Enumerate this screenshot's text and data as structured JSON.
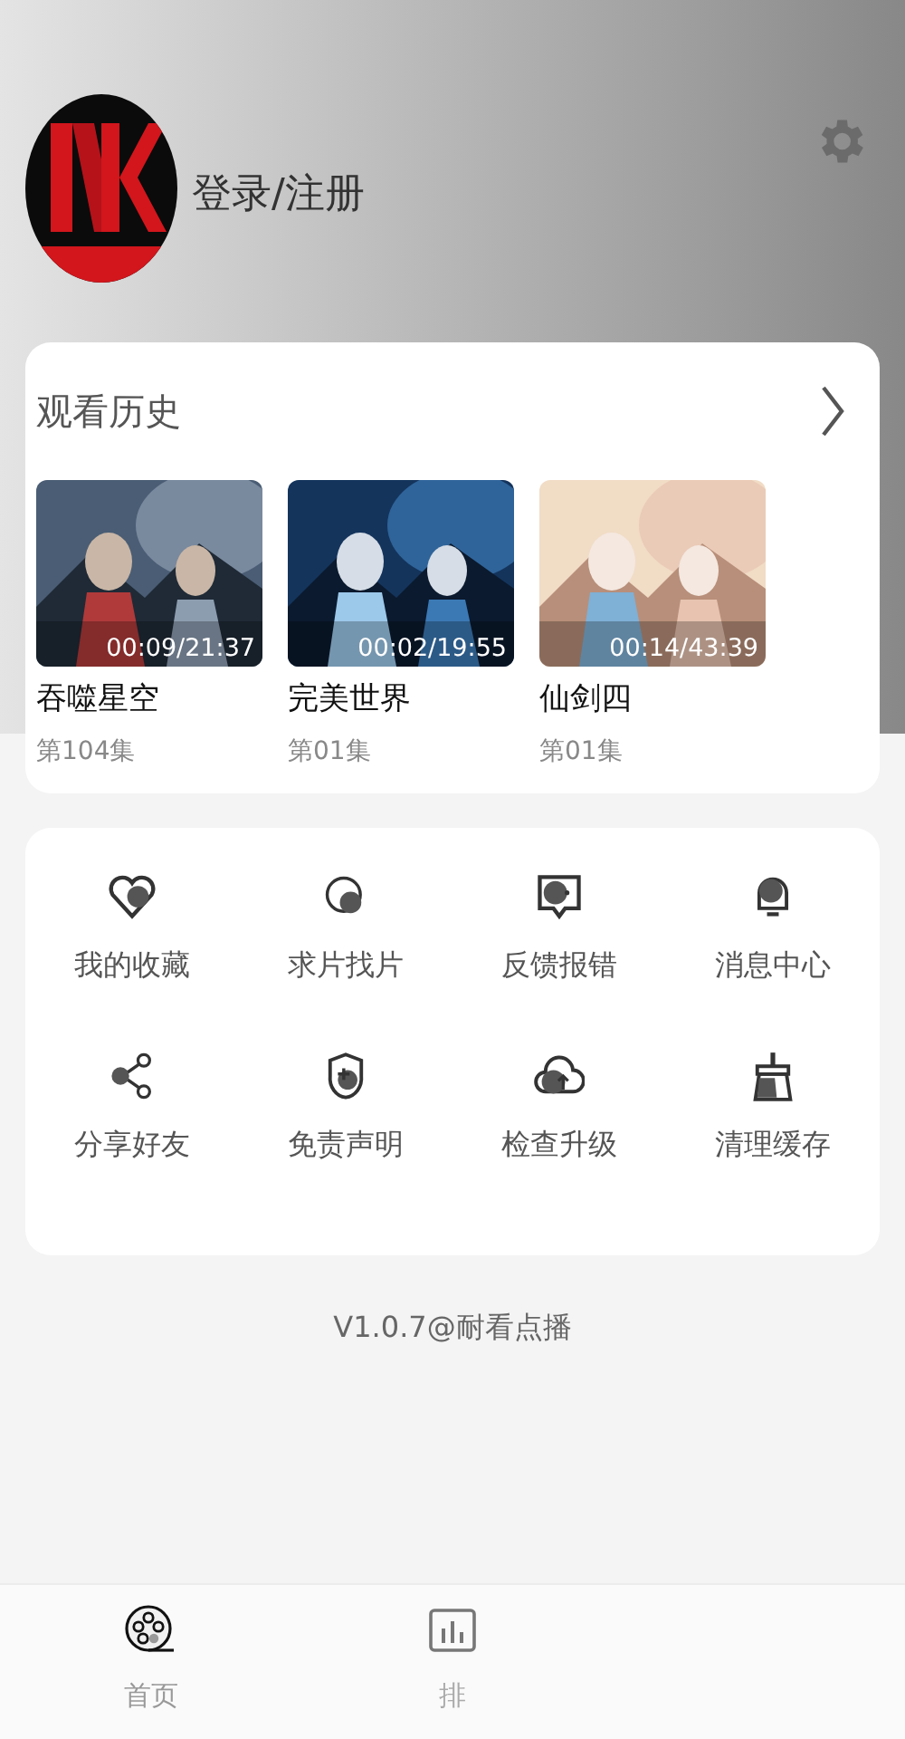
{
  "header": {
    "login_label": "登录/注册"
  },
  "history": {
    "title": "观看历史",
    "items": [
      {
        "title": "吞噬星空",
        "episode": "第104集",
        "progress": "00:09/21:37",
        "kind": "picture"
      },
      {
        "title": "完美世界",
        "episode": "第01集",
        "progress": "00:02/19:55",
        "kind": "picture"
      },
      {
        "title": "仙剑四",
        "episode": "第01集",
        "progress": "00:14/43:39",
        "kind": "picture"
      }
    ]
  },
  "menu": {
    "items": [
      {
        "label": "我的收藏"
      },
      {
        "label": "求片找片"
      },
      {
        "label": "反馈报错"
      },
      {
        "label": "消息中心"
      },
      {
        "label": "分享好友"
      },
      {
        "label": "免责声明"
      },
      {
        "label": "检查升级"
      },
      {
        "label": "清理缓存"
      }
    ]
  },
  "version": "V1.0.7@耐看点播",
  "nav": {
    "items": [
      {
        "label": "首页",
        "selected": true
      },
      {
        "label": "排",
        "selected": false
      }
    ]
  }
}
